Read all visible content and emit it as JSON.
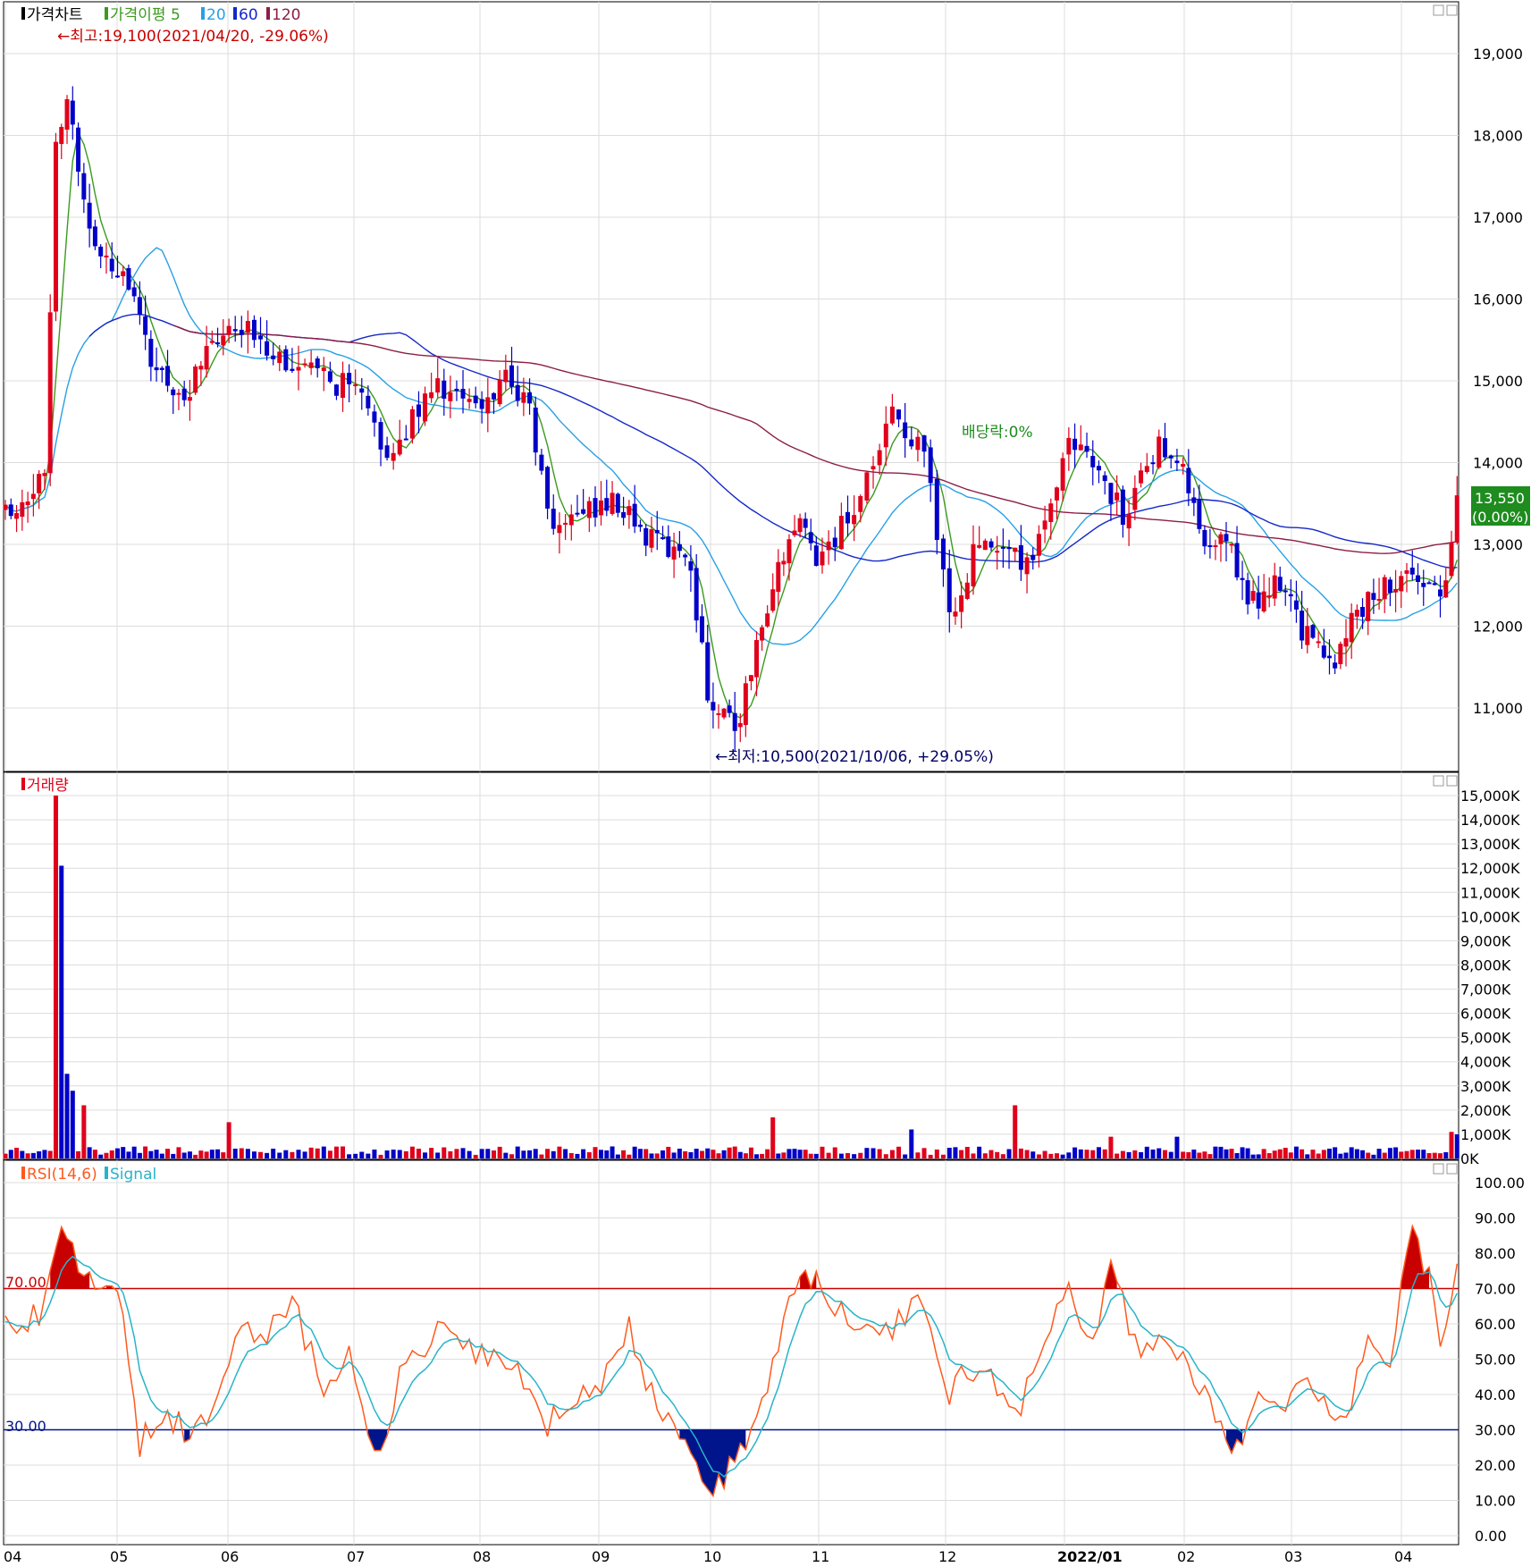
{
  "colors": {
    "up": "#e0001b",
    "down": "#0000c8",
    "ma5": "#3c9a1e",
    "ma20": "#28a0e6",
    "ma60": "#1428c8",
    "ma120": "#8c1e46",
    "grid": "#dcdcdc",
    "rsi": "#ff5a1e",
    "signal": "#28b4c8",
    "overbought": "#c80000",
    "oversold": "#00148c",
    "price_badge_bg": "#1e8c1e"
  },
  "price_panel": {
    "title": "가격차트",
    "legend": [
      {
        "label": "가격이평 5",
        "color": "#3c9a1e"
      },
      {
        "label": "20",
        "color": "#28a0e6"
      },
      {
        "label": "60",
        "color": "#1428c8"
      },
      {
        "label": "120",
        "color": "#8c1e46"
      }
    ],
    "high_annotation": "←최고:19,100(2021/04/20, -29.06%)",
    "low_annotation": "←최저:10,500(2021/10/06, +29.05%)",
    "dividend_annotation": "배당락:0%",
    "current_price": "13,550",
    "current_change": "(0.00%)",
    "y_ticks": [
      "19,000",
      "18,000",
      "17,000",
      "16,000",
      "15,000",
      "14,000",
      "13,000",
      "12,000",
      "11,000"
    ]
  },
  "volume_panel": {
    "title": "거래량",
    "y_ticks": [
      "15,000K",
      "14,000K",
      "13,000K",
      "12,000K",
      "11,000K",
      "10,000K",
      "9,000K",
      "8,000K",
      "7,000K",
      "6,000K",
      "5,000K",
      "4,000K",
      "3,000K",
      "2,000K",
      "1,000K",
      "0K"
    ]
  },
  "rsi_panel": {
    "title": "RSI(14,6)",
    "signal_label": "Signal",
    "level_high": "70.00",
    "level_low": "30.00",
    "y_ticks": [
      "100.00",
      "90.00",
      "80.00",
      "70.00",
      "60.00",
      "50.00",
      "40.00",
      "30.00",
      "20.00",
      "10.00",
      "0.00"
    ]
  },
  "x_axis": {
    "labels": [
      "04",
      "05",
      "06",
      "07",
      "08",
      "09",
      "10",
      "11",
      "12",
      "2022/01",
      "02",
      "03",
      "04"
    ]
  },
  "chart_data": {
    "type": "candlestick",
    "x_range": [
      "2021-04",
      "2022-04"
    ],
    "price_ylim": [
      10500,
      19200
    ],
    "price_series_anchors": [
      {
        "m": 0.0,
        "p": 13400
      },
      {
        "m": 0.35,
        "p": 13800
      },
      {
        "m": 0.45,
        "p": 18000
      },
      {
        "m": 0.55,
        "p": 18500
      },
      {
        "m": 0.7,
        "p": 17200
      },
      {
        "m": 0.85,
        "p": 16500
      },
      {
        "m": 1.05,
        "p": 16400
      },
      {
        "m": 1.3,
        "p": 15200
      },
      {
        "m": 1.6,
        "p": 14800
      },
      {
        "m": 1.9,
        "p": 15500
      },
      {
        "m": 2.2,
        "p": 15600
      },
      {
        "m": 2.6,
        "p": 15100
      },
      {
        "m": 3.0,
        "p": 14900
      },
      {
        "m": 3.3,
        "p": 14000
      },
      {
        "m": 3.6,
        "p": 15000
      },
      {
        "m": 4.0,
        "p": 14600
      },
      {
        "m": 4.2,
        "p": 15100
      },
      {
        "m": 4.4,
        "p": 14700
      },
      {
        "m": 4.6,
        "p": 13200
      },
      {
        "m": 4.8,
        "p": 13400
      },
      {
        "m": 5.2,
        "p": 13500
      },
      {
        "m": 5.5,
        "p": 13000
      },
      {
        "m": 5.8,
        "p": 12900
      },
      {
        "m": 6.0,
        "p": 11000
      },
      {
        "m": 6.25,
        "p": 10800
      },
      {
        "m": 6.5,
        "p": 12200
      },
      {
        "m": 6.8,
        "p": 13300
      },
      {
        "m": 7.0,
        "p": 12800
      },
      {
        "m": 7.3,
        "p": 13500
      },
      {
        "m": 7.6,
        "p": 14600
      },
      {
        "m": 7.85,
        "p": 14000
      },
      {
        "m": 8.05,
        "p": 12000
      },
      {
        "m": 8.3,
        "p": 13200
      },
      {
        "m": 8.6,
        "p": 12800
      },
      {
        "m": 8.8,
        "p": 13000
      },
      {
        "m": 9.0,
        "p": 14200
      },
      {
        "m": 9.3,
        "p": 13900
      },
      {
        "m": 9.5,
        "p": 13300
      },
      {
        "m": 9.8,
        "p": 14300
      },
      {
        "m": 10.0,
        "p": 13900
      },
      {
        "m": 10.2,
        "p": 12800
      },
      {
        "m": 10.4,
        "p": 13100
      },
      {
        "m": 10.6,
        "p": 12300
      },
      {
        "m": 10.9,
        "p": 12500
      },
      {
        "m": 11.2,
        "p": 11700
      },
      {
        "m": 11.4,
        "p": 11600
      },
      {
        "m": 11.6,
        "p": 12200
      },
      {
        "m": 11.9,
        "p": 12500
      },
      {
        "m": 12.2,
        "p": 12600
      },
      {
        "m": 12.35,
        "p": 12300
      },
      {
        "m": 12.5,
        "p": 13550
      }
    ],
    "volume_spikes_k": [
      {
        "m": 0.45,
        "v": 15000,
        "up": true
      },
      {
        "m": 0.5,
        "v": 12100,
        "up": false
      },
      {
        "m": 0.55,
        "v": 3500,
        "up": false
      },
      {
        "m": 0.6,
        "v": 2800,
        "up": false
      },
      {
        "m": 0.7,
        "v": 2200,
        "up": true
      },
      {
        "m": 2.0,
        "v": 1500,
        "up": true
      },
      {
        "m": 6.6,
        "v": 1700,
        "up": true
      },
      {
        "m": 7.75,
        "v": 1200,
        "up": false
      },
      {
        "m": 8.6,
        "v": 2200,
        "up": true
      },
      {
        "m": 9.4,
        "v": 900,
        "up": true
      },
      {
        "m": 9.95,
        "v": 900,
        "up": false
      },
      {
        "m": 12.45,
        "v": 1100,
        "up": true
      },
      {
        "m": 12.5,
        "v": 1000,
        "up": false
      }
    ],
    "rsi_anchors": [
      {
        "m": 0.0,
        "r": 60
      },
      {
        "m": 0.3,
        "r": 62
      },
      {
        "m": 0.5,
        "r": 90
      },
      {
        "m": 0.65,
        "r": 75
      },
      {
        "m": 0.85,
        "r": 70
      },
      {
        "m": 1.05,
        "r": 65
      },
      {
        "m": 1.2,
        "r": 26
      },
      {
        "m": 1.4,
        "r": 35
      },
      {
        "m": 1.7,
        "r": 28
      },
      {
        "m": 1.9,
        "r": 40
      },
      {
        "m": 2.1,
        "r": 62
      },
      {
        "m": 2.3,
        "r": 55
      },
      {
        "m": 2.5,
        "r": 68
      },
      {
        "m": 2.75,
        "r": 42
      },
      {
        "m": 2.95,
        "r": 52
      },
      {
        "m": 3.2,
        "r": 20
      },
      {
        "m": 3.4,
        "r": 50
      },
      {
        "m": 3.7,
        "r": 58
      },
      {
        "m": 4.0,
        "r": 52
      },
      {
        "m": 4.3,
        "r": 48
      },
      {
        "m": 4.55,
        "r": 30
      },
      {
        "m": 4.75,
        "r": 38
      },
      {
        "m": 5.0,
        "r": 40
      },
      {
        "m": 5.25,
        "r": 60
      },
      {
        "m": 5.5,
        "r": 38
      },
      {
        "m": 5.8,
        "r": 28
      },
      {
        "m": 6.0,
        "r": 10
      },
      {
        "m": 6.3,
        "r": 26
      },
      {
        "m": 6.6,
        "r": 50
      },
      {
        "m": 6.8,
        "r": 75
      },
      {
        "m": 7.0,
        "r": 72
      },
      {
        "m": 7.2,
        "r": 62
      },
      {
        "m": 7.5,
        "r": 55
      },
      {
        "m": 7.8,
        "r": 68
      },
      {
        "m": 8.0,
        "r": 40
      },
      {
        "m": 8.3,
        "r": 50
      },
      {
        "m": 8.6,
        "r": 32
      },
      {
        "m": 8.8,
        "r": 55
      },
      {
        "m": 9.0,
        "r": 70
      },
      {
        "m": 9.25,
        "r": 55
      },
      {
        "m": 9.4,
        "r": 78
      },
      {
        "m": 9.6,
        "r": 52
      },
      {
        "m": 9.9,
        "r": 54
      },
      {
        "m": 10.1,
        "r": 44
      },
      {
        "m": 10.3,
        "r": 35
      },
      {
        "m": 10.5,
        "r": 24
      },
      {
        "m": 10.7,
        "r": 45
      },
      {
        "m": 10.9,
        "r": 32
      },
      {
        "m": 11.1,
        "r": 44
      },
      {
        "m": 11.3,
        "r": 38
      },
      {
        "m": 11.5,
        "r": 34
      },
      {
        "m": 11.7,
        "r": 55
      },
      {
        "m": 11.9,
        "r": 50
      },
      {
        "m": 12.1,
        "r": 88
      },
      {
        "m": 12.25,
        "r": 72
      },
      {
        "m": 12.35,
        "r": 52
      },
      {
        "m": 12.5,
        "r": 78
      }
    ],
    "rsi_levels": [
      70,
      30
    ],
    "rsi_ylim": [
      0,
      100
    ]
  }
}
